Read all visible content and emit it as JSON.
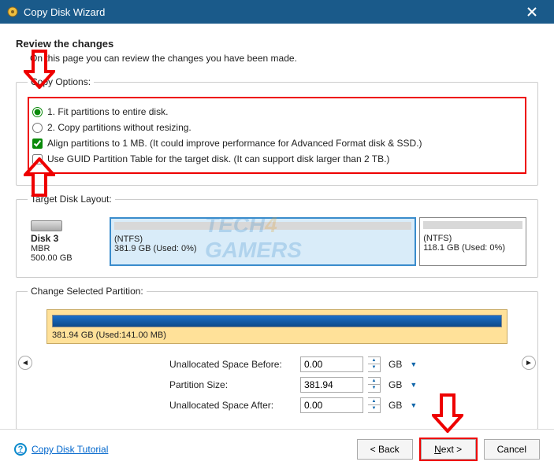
{
  "title": "Copy Disk Wizard",
  "header": {
    "title": "Review the changes",
    "desc": "On this page you can review the changes you have been made."
  },
  "copyOptions": {
    "legend": "Copy Options:",
    "radio1": "1. Fit partitions to entire disk.",
    "radio2": "2. Copy partitions without resizing.",
    "check1": "Align partitions to 1 MB.  (It could improve performance for Advanced Format disk & SSD.)",
    "check2": "Use GUID Partition Table for the target disk. (It can support disk larger than 2 TB.)"
  },
  "targetLayout": {
    "legend": "Target Disk Layout:",
    "diskName": "Disk 3",
    "diskType": "MBR",
    "diskSize": "500.00 GB",
    "part1": {
      "fs": "(NTFS)",
      "info": "381.9 GB (Used: 0%)"
    },
    "part2": {
      "fs": "(NTFS)",
      "info": "118.1 GB (Used: 0%)"
    }
  },
  "changeSel": {
    "legend": "Change Selected Partition:",
    "info": "381.94 GB (Used:141.00 MB)"
  },
  "form": {
    "beforeLabel": "Unallocated Space Before:",
    "beforeVal": "0.00",
    "sizeLabel": "Partition Size:",
    "sizeVal": "381.94",
    "afterLabel": "Unallocated Space After:",
    "afterVal": "0.00",
    "unit": "GB"
  },
  "footer": {
    "help": "Copy Disk Tutorial",
    "back": "< Back",
    "next": "Next >",
    "cancel": "Cancel"
  }
}
